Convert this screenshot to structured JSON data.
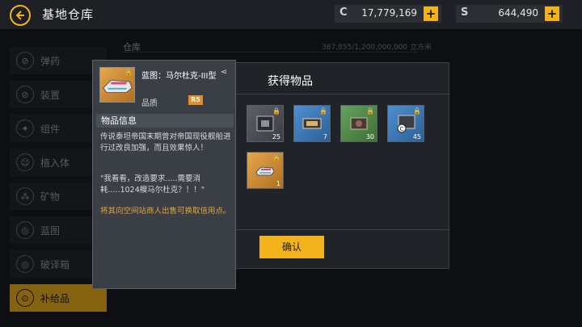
{
  "header": {
    "title": "基地仓库",
    "currencies": [
      {
        "icon": "C",
        "value": "17,779,169"
      },
      {
        "icon": "S",
        "value": "644,490"
      }
    ]
  },
  "sidebar": {
    "items": [
      {
        "label": "弹药",
        "icon": "ammo-icon",
        "glyph": "⊘"
      },
      {
        "label": "装置",
        "icon": "device-icon",
        "glyph": "⊘"
      },
      {
        "label": "组件",
        "icon": "component-icon",
        "glyph": "✦"
      },
      {
        "label": "植入体",
        "icon": "implant-icon",
        "glyph": "☺"
      },
      {
        "label": "矿物",
        "icon": "mineral-icon",
        "glyph": "⁂"
      },
      {
        "label": "蓝图",
        "icon": "blueprint-icon",
        "glyph": "◎"
      },
      {
        "label": "破译箱",
        "icon": "decrypt-box-icon",
        "glyph": "◎"
      },
      {
        "label": "补给品",
        "icon": "supply-icon",
        "glyph": "⊙",
        "active": true
      }
    ]
  },
  "storage": {
    "label": "仓库",
    "value": "387,855/1,200,000,000 立方米"
  },
  "dialog": {
    "title": "获得物品",
    "confirm_label": "确认",
    "items": [
      {
        "rarity": "gray",
        "qty": "25",
        "icon": "module-icon"
      },
      {
        "rarity": "blue",
        "qty": "7",
        "icon": "chip-icon"
      },
      {
        "rarity": "green",
        "qty": "30",
        "icon": "device-icon"
      },
      {
        "rarity": "blue",
        "qty": "45",
        "icon": "credit-chip-icon"
      },
      {
        "rarity": "gold",
        "qty": "1",
        "icon": "ship-blueprint-icon"
      }
    ]
  },
  "tooltip": {
    "name": "蓝图：马尔杜克-III型",
    "quality_label": "品质",
    "quality_value": "R5",
    "section_title": "物品信息",
    "desc": "传说泰坦帝国末期曾对帝国现役舰船进行过改良加强，而且效果惊人！",
    "quote": "\"我看看，改造要求.....需要消耗.....1024艘马尔杜克？！！\"",
    "note": "将其向空间站商人出售可换取信用点。"
  },
  "colors": {
    "accent": "#f2b31c",
    "quality": "#e8892a"
  }
}
